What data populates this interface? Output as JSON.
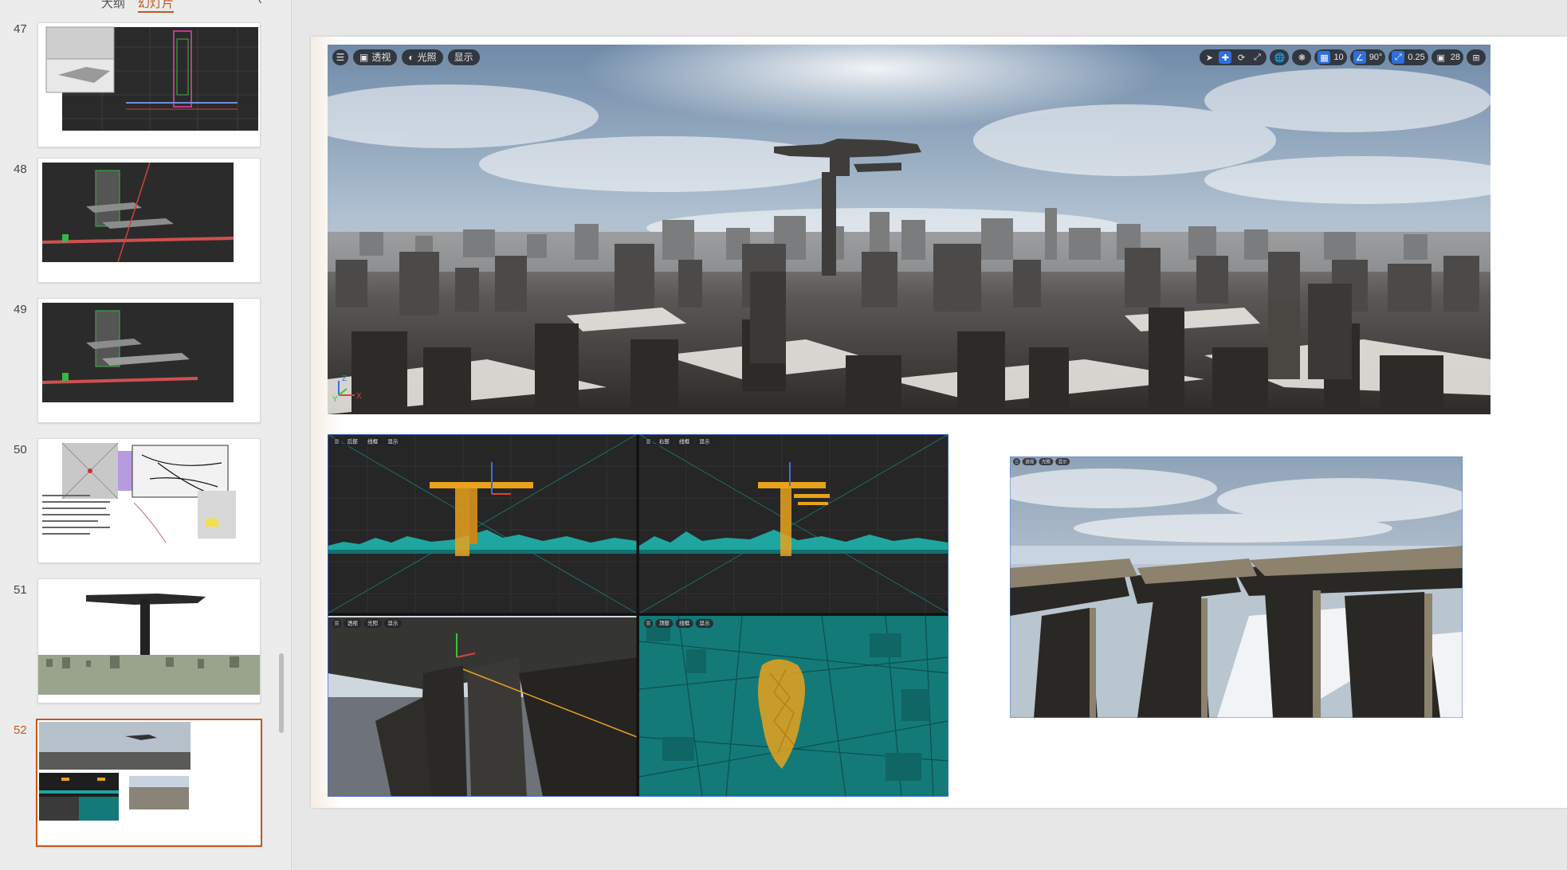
{
  "pane": {
    "tabs": [
      {
        "label": "大纲",
        "active": false
      },
      {
        "label": "幻灯片",
        "active": true
      }
    ],
    "collapse_icon": "chevron-left-icon",
    "slides": [
      {
        "number": "47",
        "active": false
      },
      {
        "number": "48",
        "active": false
      },
      {
        "number": "49",
        "active": false
      },
      {
        "number": "50",
        "active": false
      },
      {
        "number": "51",
        "active": false
      },
      {
        "number": "52",
        "active": true
      }
    ]
  },
  "viewport_main": {
    "toolbar_left": {
      "menu_icon": "hamburger-icon",
      "view_label": "透视",
      "lighting_label": "光照",
      "show_label": "显示"
    },
    "toolbar_right": {
      "grid_snap": "10",
      "angle_snap": "90°",
      "scale_snap": "0.25",
      "camera_speed": "28"
    },
    "axis_labels": {
      "x": "X",
      "y": "Y",
      "z": "Z"
    }
  },
  "viewport_quad": {
    "panels": [
      {
        "view_label": "后部",
        "mode_label": "线框",
        "show_label": "显示"
      },
      {
        "view_label": "右部",
        "mode_label": "线框",
        "show_label": "显示"
      },
      {
        "view_label": "透视",
        "mode_label": "光照",
        "show_label": "显示"
      },
      {
        "view_label": "顶部",
        "mode_label": "线框",
        "show_label": "显示"
      }
    ]
  },
  "colors": {
    "accent": "#c4581d",
    "wire_teal": "#1fa6a0",
    "wire_orange": "#e8a21c",
    "viewport_dark": "#1c1c1c",
    "active_blue": "#2f6fdb"
  }
}
